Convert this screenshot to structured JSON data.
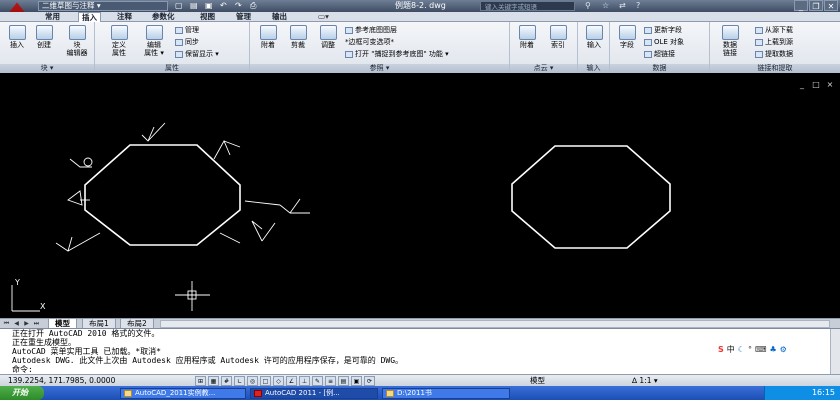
{
  "titlebar": {
    "workspace": "二维草图与注释",
    "document_title": "例题8-2. dwg",
    "search_placeholder": "键入关键字或短语",
    "qat_icons": [
      "new-file-icon",
      "open-icon",
      "save-icon",
      "undo-icon",
      "redo-icon",
      "print-icon"
    ],
    "title_icons": [
      "binoculars-icon",
      "star-icon",
      "exchange-icon",
      "help-icon"
    ],
    "window_buttons": [
      "minimize",
      "restore",
      "close"
    ]
  },
  "tabs": [
    "常用",
    "插入",
    "注释",
    "参数化",
    "视图",
    "管理",
    "输出"
  ],
  "active_tab": "插入",
  "ribbon": {
    "panels": {
      "block": {
        "title": "块 ▾",
        "insert": "插入",
        "create": "创建",
        "block_editor": "块\n编辑器"
      },
      "attributes": {
        "title": "属性",
        "define_attr": "定义\n属性",
        "edit_attr": "编辑\n属性 ▾",
        "manage": "管理",
        "sync": "同步",
        "keep_display": "保留显示 ▾"
      },
      "reference": {
        "title": "参照 ▾",
        "attach": "附着",
        "clip": "剪裁",
        "adjust": "调整",
        "underlay_layers": "参考底图图层",
        "frame_variable": "*边框可变选项*",
        "snap_to_underlay": "打开 \"捕捉到参考底图\" 功能 ▾"
      },
      "point_cloud": {
        "title": "点云 ▾",
        "attach": "附着",
        "index": "索引"
      },
      "import": {
        "title": "输入",
        "import": "输入"
      },
      "data": {
        "title": "数据",
        "field": "字段",
        "update_fields": "更新字段",
        "ole_object": "OLE 对象",
        "hyperlink": "超链接"
      },
      "linking": {
        "title": "链接和提取",
        "data_link": "数据\n链接",
        "download_source": "从源下载",
        "upload_source": "上载到源",
        "extract_data": "提取数据"
      }
    }
  },
  "viewport_controls": [
    "_",
    "□",
    "×"
  ],
  "layout_tabs": [
    "模型",
    "布局1",
    "布局2"
  ],
  "active_layout": "模型",
  "command_history": [
    "正在打开 AutoCAD 2010 格式的文件。",
    "正在重生成模型。",
    "AutoCAD 菜单实用工具 已加载。*取消*",
    "Autodesk DWG.   此文件上次由 Autodesk 应用程序或 Autodesk 许可的应用程序保存，是可靠的 DWG。",
    "命令:"
  ],
  "ime_bar": [
    "S",
    "中",
    "☾",
    "°",
    "⌨",
    "♣",
    "⚙"
  ],
  "statusbar": {
    "coordinates": "139.2254, 171.7985, 0.0000",
    "model": "模型",
    "annotation_scale": "∆ 1:1 ▾"
  },
  "taskbar": {
    "start": "开始",
    "items": [
      "AutoCAD_2011实例教...",
      "AutoCAD 2011 - [例...",
      "D:\\2011书"
    ],
    "active_index": 1,
    "clock": "16:15"
  },
  "colors": {
    "canvas": "#000000",
    "linework": "#ffffff",
    "taskbar": "#245edb"
  }
}
